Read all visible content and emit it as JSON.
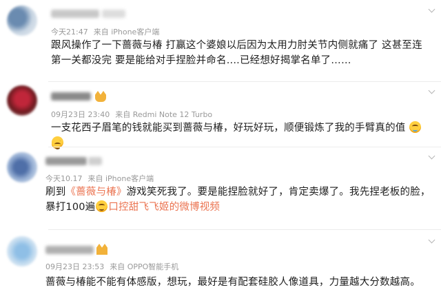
{
  "comments": [
    {
      "time": "今天21:47",
      "source": "来自 iPhone客户端",
      "text": "跟风操作了一下蔷薇与椿 打赢这个婆娘以后因为太用力肘关节内侧就痛了 这甚至连第一关都没完 要是能给对手捏脸并命名....已经想好揭掌名单了……"
    },
    {
      "time": "09月23日 23:40",
      "source": "来自 Redmi Note 12 Turbo",
      "text": "一支花西子眉笔的钱就能买到蔷薇与椿，好玩好玩，顺便锻炼了我的手臂真的值",
      "emoji": [
        "tear-laugh",
        "tear-laugh"
      ]
    },
    {
      "time": "今天10.17",
      "source": "来自 iPhone客户端",
      "text_before": "刷到",
      "topic": "《蔷薇与椿》",
      "text_after": "游戏笑死我了。要是能捏脸就好了，肯定卖爆了。我先捏老板的脸，",
      "text_line2": "暴打100遍",
      "video_link": "口控甜飞飞姬的微博视频"
    },
    {
      "time": "09月23日 23:53",
      "source": "来自 OPPO智能手机",
      "text": "蔷薇与椿能不能有体感版，想玩，最好是有配套硅胶人像道具，力量越大分数越高。"
    }
  ],
  "colors": {
    "accent": "#eb7350",
    "meta": "#999999"
  }
}
